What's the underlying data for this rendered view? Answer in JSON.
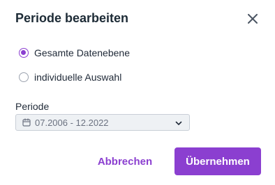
{
  "dialog": {
    "title": "Periode bearbeiten",
    "close_icon": "close-icon"
  },
  "options": [
    {
      "label": "Gesamte Datenebene",
      "selected": true
    },
    {
      "label": "individuelle Auswahl",
      "selected": false
    }
  ],
  "period": {
    "label": "Periode",
    "value": "07.2006 - 12.2022",
    "calendar_icon": "calendar-icon",
    "chevron_icon": "chevron-down-icon"
  },
  "actions": {
    "cancel_label": "Abbrechen",
    "apply_label": "Übernehmen"
  },
  "colors": {
    "accent": "#8b3fd0",
    "title": "#1d2b36",
    "select_bg": "#eef1f4"
  }
}
